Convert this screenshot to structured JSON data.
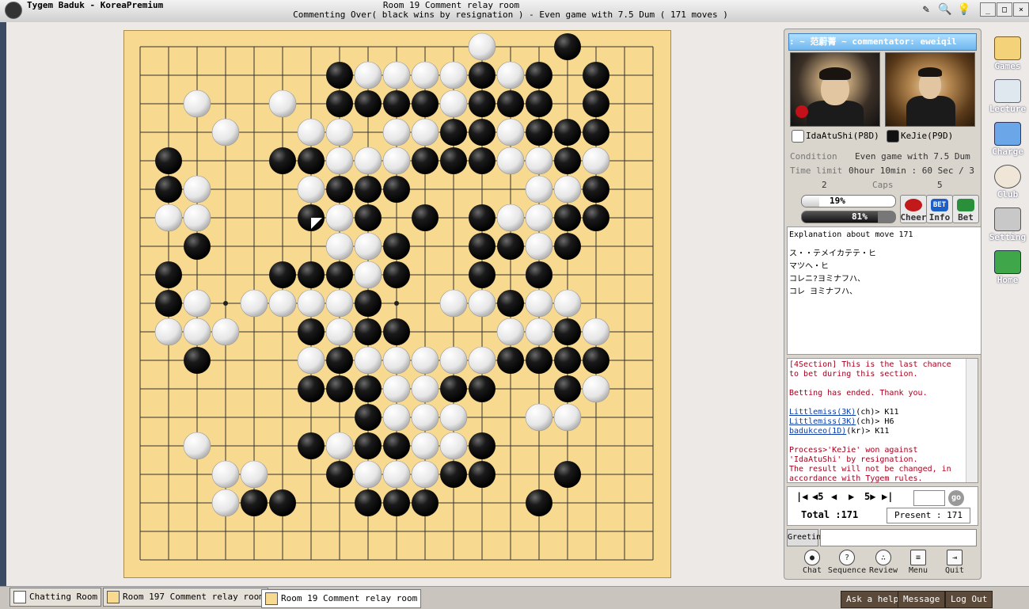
{
  "window": {
    "app_title": "Tygem Baduk - KoreaPremium",
    "room_title": "Room 19 Comment relay room",
    "subtitle": "Commenting Over( black wins by resignation ) - Even game with 7.5 Dum  ( 171 moves )"
  },
  "board": {
    "size": 19,
    "hoshi": [
      [
        3,
        3
      ],
      [
        9,
        3
      ],
      [
        15,
        3
      ],
      [
        3,
        9
      ],
      [
        9,
        9
      ],
      [
        15,
        9
      ],
      [
        3,
        15
      ],
      [
        9,
        15
      ],
      [
        15,
        15
      ]
    ],
    "last_move": [
      6,
      6
    ],
    "black": [
      [
        15,
        0
      ],
      [
        7,
        1
      ],
      [
        12,
        1
      ],
      [
        14,
        1
      ],
      [
        16,
        1
      ],
      [
        7,
        2
      ],
      [
        8,
        2
      ],
      [
        9,
        2
      ],
      [
        10,
        2
      ],
      [
        12,
        2
      ],
      [
        13,
        2
      ],
      [
        14,
        2
      ],
      [
        16,
        2
      ],
      [
        11,
        3
      ],
      [
        12,
        3
      ],
      [
        14,
        3
      ],
      [
        15,
        3
      ],
      [
        16,
        3
      ],
      [
        1,
        4
      ],
      [
        5,
        4
      ],
      [
        6,
        4
      ],
      [
        10,
        4
      ],
      [
        11,
        4
      ],
      [
        12,
        4
      ],
      [
        15,
        4
      ],
      [
        1,
        5
      ],
      [
        7,
        5
      ],
      [
        8,
        5
      ],
      [
        9,
        5
      ],
      [
        16,
        5
      ],
      [
        6,
        6
      ],
      [
        8,
        6
      ],
      [
        10,
        6
      ],
      [
        12,
        6
      ],
      [
        15,
        6
      ],
      [
        16,
        6
      ],
      [
        2,
        7
      ],
      [
        9,
        7
      ],
      [
        12,
        7
      ],
      [
        13,
        7
      ],
      [
        15,
        7
      ],
      [
        1,
        8
      ],
      [
        5,
        8
      ],
      [
        6,
        8
      ],
      [
        7,
        8
      ],
      [
        9,
        8
      ],
      [
        12,
        8
      ],
      [
        14,
        8
      ],
      [
        1,
        9
      ],
      [
        8,
        9
      ],
      [
        13,
        9
      ],
      [
        6,
        10
      ],
      [
        8,
        10
      ],
      [
        9,
        10
      ],
      [
        15,
        10
      ],
      [
        2,
        11
      ],
      [
        7,
        11
      ],
      [
        13,
        11
      ],
      [
        14,
        11
      ],
      [
        15,
        11
      ],
      [
        16,
        11
      ],
      [
        6,
        12
      ],
      [
        7,
        12
      ],
      [
        8,
        12
      ],
      [
        11,
        12
      ],
      [
        12,
        12
      ],
      [
        15,
        12
      ],
      [
        8,
        13
      ],
      [
        6,
        14
      ],
      [
        8,
        14
      ],
      [
        9,
        14
      ],
      [
        12,
        14
      ],
      [
        7,
        15
      ],
      [
        11,
        15
      ],
      [
        12,
        15
      ],
      [
        15,
        15
      ],
      [
        4,
        16
      ],
      [
        5,
        16
      ],
      [
        8,
        16
      ],
      [
        9,
        16
      ],
      [
        10,
        16
      ],
      [
        14,
        16
      ]
    ],
    "white": [
      [
        12,
        0
      ],
      [
        8,
        1
      ],
      [
        9,
        1
      ],
      [
        10,
        1
      ],
      [
        11,
        1
      ],
      [
        13,
        1
      ],
      [
        2,
        2
      ],
      [
        5,
        2
      ],
      [
        11,
        2
      ],
      [
        3,
        3
      ],
      [
        6,
        3
      ],
      [
        7,
        3
      ],
      [
        9,
        3
      ],
      [
        10,
        3
      ],
      [
        13,
        3
      ],
      [
        7,
        4
      ],
      [
        8,
        4
      ],
      [
        9,
        4
      ],
      [
        13,
        4
      ],
      [
        14,
        4
      ],
      [
        16,
        4
      ],
      [
        2,
        5
      ],
      [
        6,
        5
      ],
      [
        14,
        5
      ],
      [
        15,
        5
      ],
      [
        1,
        6
      ],
      [
        2,
        6
      ],
      [
        7,
        6
      ],
      [
        13,
        6
      ],
      [
        14,
        6
      ],
      [
        7,
        7
      ],
      [
        8,
        7
      ],
      [
        14,
        7
      ],
      [
        8,
        8
      ],
      [
        14,
        8
      ],
      [
        2,
        9
      ],
      [
        4,
        9
      ],
      [
        5,
        9
      ],
      [
        6,
        9
      ],
      [
        7,
        9
      ],
      [
        11,
        9
      ],
      [
        12,
        9
      ],
      [
        14,
        9
      ],
      [
        15,
        9
      ],
      [
        1,
        10
      ],
      [
        2,
        10
      ],
      [
        3,
        10
      ],
      [
        7,
        10
      ],
      [
        13,
        10
      ],
      [
        14,
        10
      ],
      [
        16,
        10
      ],
      [
        6,
        11
      ],
      [
        8,
        11
      ],
      [
        9,
        11
      ],
      [
        10,
        11
      ],
      [
        11,
        11
      ],
      [
        12,
        11
      ],
      [
        9,
        12
      ],
      [
        10,
        12
      ],
      [
        16,
        12
      ],
      [
        9,
        13
      ],
      [
        10,
        13
      ],
      [
        11,
        13
      ],
      [
        14,
        13
      ],
      [
        15,
        13
      ],
      [
        2,
        14
      ],
      [
        7,
        14
      ],
      [
        10,
        14
      ],
      [
        11,
        14
      ],
      [
        3,
        15
      ],
      [
        4,
        15
      ],
      [
        8,
        15
      ],
      [
        9,
        15
      ],
      [
        10,
        15
      ],
      [
        3,
        16
      ]
    ]
  },
  "commentator": ": ~ 范蔚菁 ~ commentator: eweiqil",
  "players": {
    "white": {
      "name": "IdaAtuShi(P8D)"
    },
    "black": {
      "name": "KeJie(P9D)"
    }
  },
  "game_info": {
    "condition_label": "Condition",
    "condition_value": "Even game with 7.5 Dum",
    "time_label": "Time limit",
    "time_value": "0hour 10min : 60 Sec / 3",
    "caps_label": "Caps",
    "caps_white": "2",
    "caps_black": "5"
  },
  "bet": {
    "white_percent_label": "19%",
    "black_percent_label": "81%",
    "white_fraction": 0.19,
    "black_fraction": 0.81,
    "cheer_label": "Cheer",
    "info_label": "Info",
    "bet_label": "Bet",
    "bet_icon_text": "BET"
  },
  "explanation": {
    "title": "Explanation about move 171",
    "lines": [
      "ス・・テメイカテテ・ヒ",
      "マツヘ・ヒ",
      "コレニ?ヨミナフハ、",
      "コレ ヨミナフハ、"
    ]
  },
  "chat": {
    "l1": "[4Section] This is the last chance",
    "l2": "to bet during this section.",
    "l3": "Betting has ended. Thank you.",
    "m1_user": "Littlemiss(3K)",
    "m1_text": "(ch)> K11",
    "m2_user": "Littlemiss(3K)",
    "m2_text": "(ch)> H6",
    "m3_user": "badukceo(1D)",
    "m3_text": "(kr)> K11",
    "p1": "Process>'KeJie' won against",
    "p2": "'IdaAtuShi' by resignation.",
    "p3": "The result will not be changed, in",
    "p4": "accordance with Tygem rules."
  },
  "navigation": {
    "first": "|◀",
    "back5": "◀5",
    "prev": "◀",
    "next": "▶",
    "fwd5": "5▶",
    "last": "▶|",
    "go_label": "go",
    "total": "Total :171",
    "present": "Present : 171"
  },
  "greeting_label": "Greeting",
  "bottom_buttons": {
    "chat": "Chat",
    "sequence": "Sequence",
    "review": "Review",
    "menu": "Menu",
    "quit": "Quit"
  },
  "side_menu": {
    "games": "Games",
    "lecture": "Lecture",
    "charge": "Charge",
    "club": "Club",
    "setting": "Setting",
    "home": "Home"
  },
  "tabs": {
    "chatting_room": "Chatting Room",
    "room197": "Room 197 Comment relay room",
    "room19": "Room 19 Comment relay room"
  },
  "footer": {
    "ask_help": "Ask a help",
    "message": "Message",
    "log_out": "Log Out"
  }
}
